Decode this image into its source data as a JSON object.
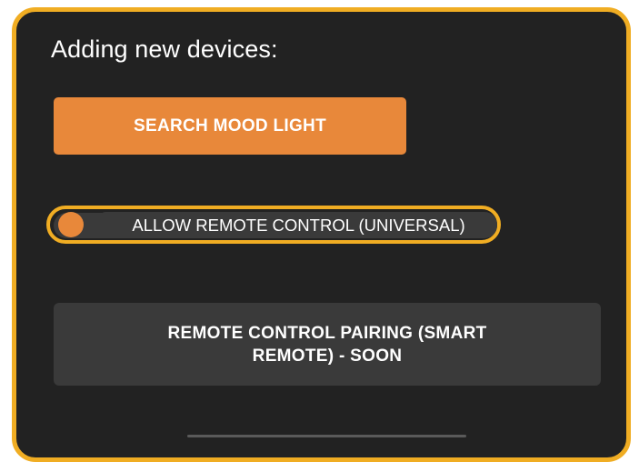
{
  "panel": {
    "heading": "Adding new devices:",
    "search_button": "SEARCH MOOD LIGHT",
    "remote_toggle": {
      "label": "ALLOW REMOTE CONTROL (UNIVERSAL)",
      "enabled": false
    },
    "pairing_button": "REMOTE CONTROL PAIRING (SMART REMOTE) - SOON"
  },
  "colors": {
    "accent_orange": "#e8883a",
    "border_yellow": "#f0ad23",
    "panel_background": "#222222",
    "control_background": "#3a3a3a"
  }
}
